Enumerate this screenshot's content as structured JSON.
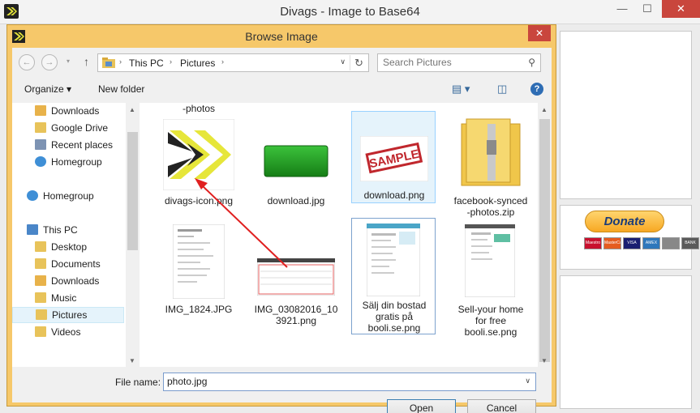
{
  "main": {
    "title": "Divags - Image to Base64",
    "close_glyph": "✕",
    "minimize_glyph": "—",
    "maximize_glyph": "☐",
    "donate_label": "Donate",
    "cards": [
      "Maestro",
      "MasterCard",
      "VISA",
      "AMEX",
      "",
      "BANK"
    ]
  },
  "dialog": {
    "title": "Browse Image",
    "close_glyph": "✕",
    "nav": {
      "back_glyph": "←",
      "forward_glyph": "→",
      "up_glyph": "↑",
      "breadcrumb": [
        "This PC",
        "Pictures"
      ],
      "breadcrumb_separator": "›",
      "dropdown_glyph": "∨",
      "refresh_glyph": "↻"
    },
    "search": {
      "placeholder": "Search Pictures",
      "icon_glyph": "⚲"
    },
    "toolbar": {
      "organize_label": "Organize ▾",
      "new_folder_label": "New folder",
      "view_glyph": "▤ ▾",
      "pane_glyph": "◫",
      "help_glyph": "?"
    },
    "tree": [
      {
        "label": "Downloads",
        "icon": "folder-download-icon",
        "indent": 1,
        "color": "#e8b24a"
      },
      {
        "label": "Google Drive",
        "icon": "folder-icon",
        "indent": 1,
        "color": "#e8c35a"
      },
      {
        "label": "Recent places",
        "icon": "recent-places-icon",
        "indent": 1,
        "color": "#7d93b3"
      },
      {
        "label": "Homegroup",
        "icon": "homegroup-icon",
        "indent": 1,
        "color": "#3f8fd6"
      },
      {
        "label": "Homegroup",
        "icon": "homegroup-icon",
        "indent": 0,
        "color": "#3f8fd6"
      },
      {
        "label": "This PC",
        "icon": "computer-icon",
        "indent": 0,
        "color": "#4a86c8"
      },
      {
        "label": "Desktop",
        "icon": "folder-desktop-icon",
        "indent": 1,
        "color": "#e8c35a"
      },
      {
        "label": "Documents",
        "icon": "folder-documents-icon",
        "indent": 1,
        "color": "#e8c35a"
      },
      {
        "label": "Downloads",
        "icon": "folder-download-icon",
        "indent": 1,
        "color": "#e8b24a"
      },
      {
        "label": "Music",
        "icon": "folder-music-icon",
        "indent": 1,
        "color": "#e8c35a"
      },
      {
        "label": "Pictures",
        "icon": "folder-pictures-icon",
        "indent": 1,
        "color": "#e8c35a"
      },
      {
        "label": "Videos",
        "icon": "folder-videos-icon",
        "indent": 1,
        "color": "#e8c35a"
      }
    ],
    "files": {
      "header_label": "-photos",
      "items": [
        {
          "label": "divags-icon.png",
          "kind": "divags"
        },
        {
          "label": "download.jpg",
          "kind": "green"
        },
        {
          "label": "download.png",
          "kind": "sample",
          "thumb_text": "SAMPLE"
        },
        {
          "label": "facebook-synced\n-photos.zip",
          "kind": "zip"
        },
        {
          "label": "IMG_1824.JPG",
          "kind": "doc"
        },
        {
          "label": "IMG_03082016_10\n3921.png",
          "kind": "sheet"
        },
        {
          "label": "Sälj din bostad\ngratis på\nbooli.se.png",
          "kind": "web"
        },
        {
          "label": "Sell-your home\nfor free\nbooli.se.png",
          "kind": "web2"
        }
      ]
    },
    "bottom": {
      "file_name_label": "File name:",
      "file_name_value": "photo.jpg",
      "open_label": "Open",
      "cancel_label": "Cancel"
    }
  },
  "colors": {
    "dialog_frame": "#f6c86a",
    "close_red": "#c9463d",
    "annotation_arrow": "#e02020"
  }
}
